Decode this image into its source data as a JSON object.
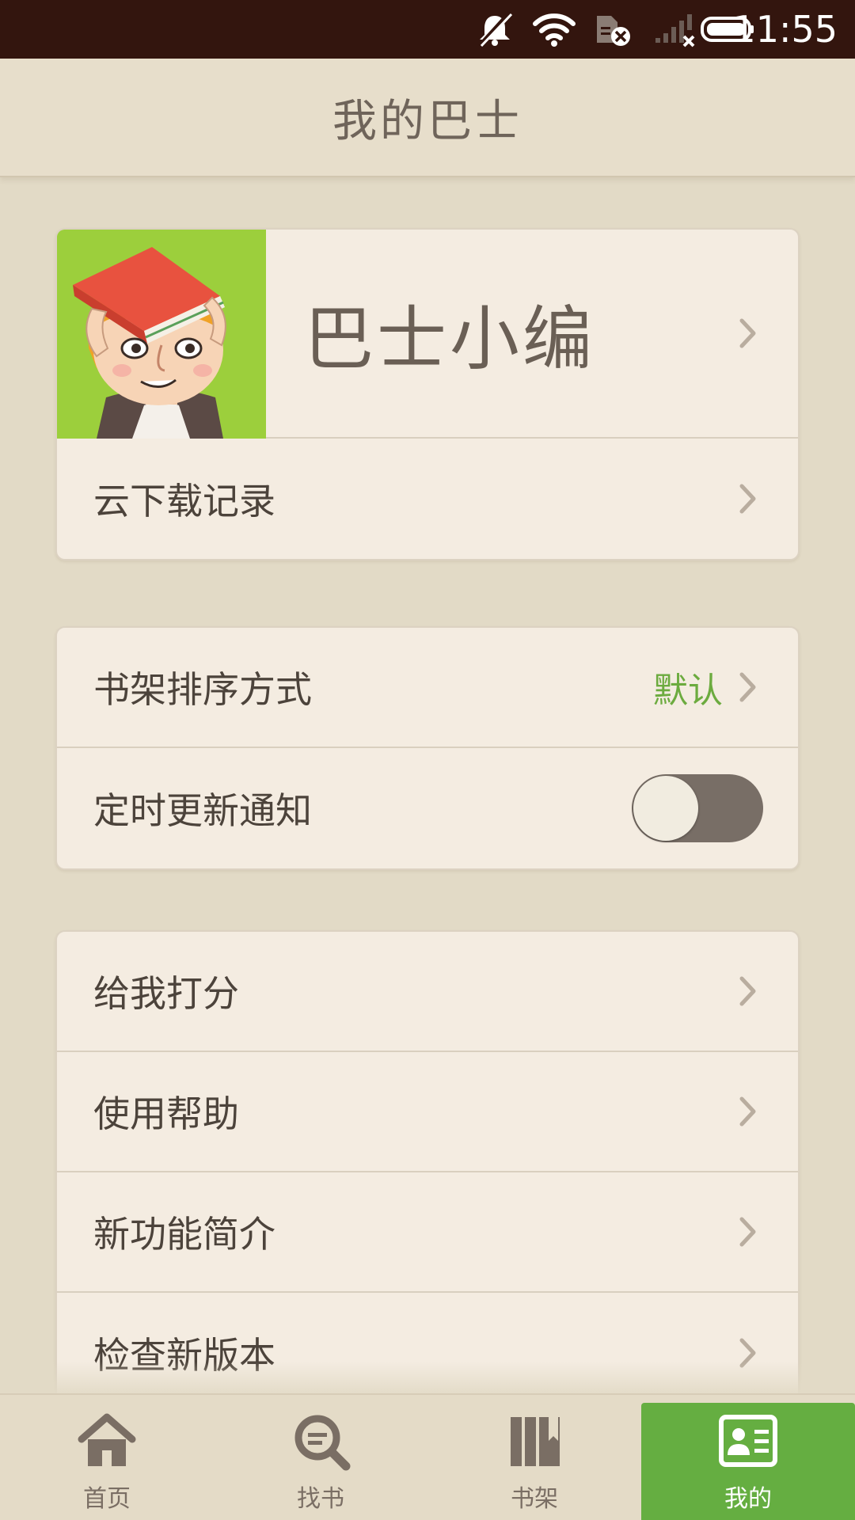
{
  "status_bar": {
    "time": "11:55"
  },
  "header": {
    "title": "我的巴士"
  },
  "profile": {
    "name": "巴士小编"
  },
  "account_card": {
    "cloud_download": "云下载记录"
  },
  "settings_card": {
    "shelf_sort_label": "书架排序方式",
    "shelf_sort_value": "默认",
    "update_notify_label": "定时更新通知",
    "update_notify_on": false
  },
  "info_card": {
    "items": [
      "给我打分",
      "使用帮助",
      "新功能简介",
      "检查新版本"
    ]
  },
  "bottom_nav": {
    "items": [
      {
        "label": "首页",
        "icon": "home-icon"
      },
      {
        "label": "找书",
        "icon": "search-book-icon"
      },
      {
        "label": "书架",
        "icon": "bookshelf-icon"
      },
      {
        "label": "我的",
        "icon": "profile-card-icon",
        "active": true
      }
    ]
  },
  "colors": {
    "status_bar": "#33150e",
    "background": "#e2dac6",
    "card": "#f4ece1",
    "accent_green": "#65ae41",
    "value_green": "#6cab3f"
  }
}
